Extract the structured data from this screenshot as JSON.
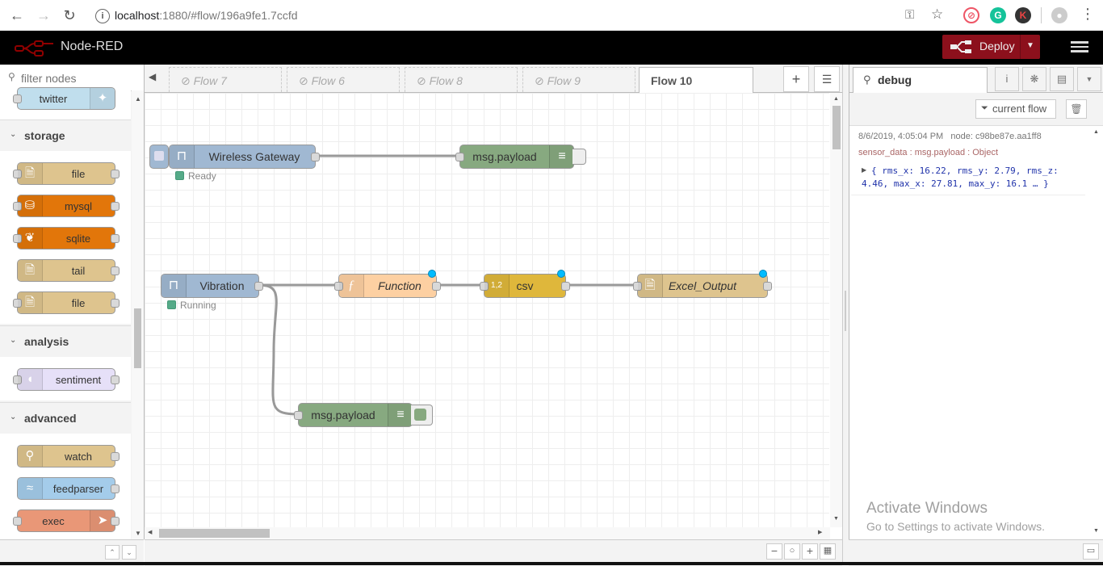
{
  "browser": {
    "url_host": "localhost",
    "url_rest": ":1880/#flow/196a9fe1.7ccfd"
  },
  "header": {
    "brand": "Node-RED",
    "deploy_label": "Deploy"
  },
  "palette": {
    "filter_placeholder": "filter nodes",
    "top_node": "twitter",
    "categories": [
      {
        "name": "storage",
        "nodes": [
          "file",
          "mysql",
          "sqlite",
          "tail",
          "file"
        ]
      },
      {
        "name": "analysis",
        "nodes": [
          "sentiment"
        ]
      },
      {
        "name": "advanced",
        "nodes": [
          "watch",
          "feedparser",
          "exec"
        ]
      }
    ]
  },
  "tabs": [
    "Flow 7",
    "Flow 6",
    "Flow 8",
    "Flow 9",
    "Flow 10"
  ],
  "flow": {
    "nodes": {
      "wireless_gateway": "Wireless Gateway",
      "wireless_status": "Ready",
      "debug1": "msg.payload",
      "vibration": "Vibration",
      "vibration_status": "Running",
      "function": "Function",
      "csv": "csv",
      "excel": "Excel_Output",
      "debug2": "msg.payload"
    }
  },
  "sidebar": {
    "tab_label": "debug",
    "filter_label": "current flow",
    "message": {
      "timestamp": "8/6/2019, 4:05:04 PM",
      "node": "node: c98be87e.aa1ff8",
      "topic": "sensor_data : msg.payload : Object",
      "payload": "{ rms_x: 16.22, rms_y: 2.79, rms_z: 4.46, max_x: 27.81, max_y: 16.1 … }"
    }
  },
  "watermark": {
    "title": "Activate Windows",
    "subtitle": "Go to Settings to activate Windows."
  },
  "colors": {
    "header": "#000000",
    "deploy": "#8c101c",
    "storage_node": "#dec48e",
    "mysql_node": "#e2760a",
    "analysis_node": "#e6e0f8",
    "feedparser_node": "#a4ccea",
    "exec_node": "#e99777",
    "debug_node": "#87a980",
    "function_node": "#fdd0a2",
    "csv_node": "#dfb73b",
    "wireless_node": "#a0b8d2"
  }
}
